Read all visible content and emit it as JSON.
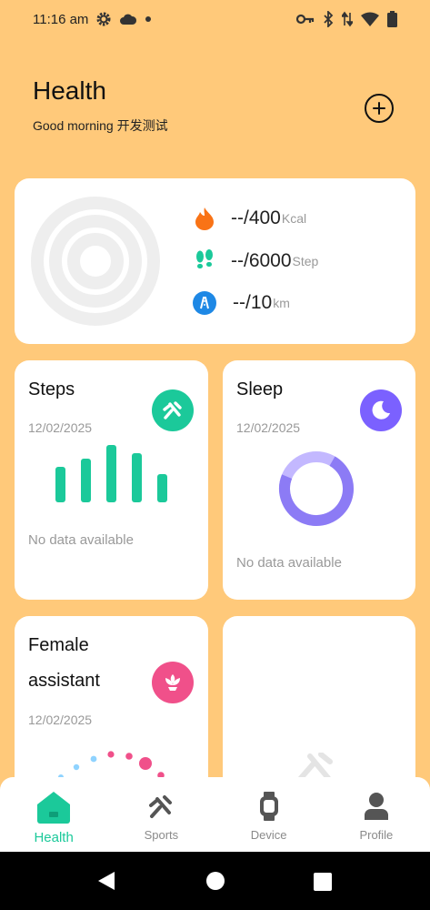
{
  "status_bar": {
    "time": "11:16 am",
    "icons": [
      "settings-gear-icon",
      "cloud-icon",
      "dot-icon",
      "key-icon",
      "bluetooth-icon",
      "data-arrows-icon",
      "wifi-icon",
      "battery-icon"
    ]
  },
  "header": {
    "title": "Health",
    "greeting": "Good morning 开发测试",
    "add_icon": "plus-circle-icon"
  },
  "summary": {
    "calories": {
      "value": "--/400",
      "unit": "Kcal",
      "icon": "flame-icon",
      "color": "#F97316"
    },
    "steps": {
      "value": "--/6000",
      "unit": "Step",
      "icon": "footprints-icon",
      "color": "#1BC99A"
    },
    "distance": {
      "value": "--/10",
      "unit": "km",
      "icon": "road-icon",
      "color": "#1E88E5"
    }
  },
  "tiles": {
    "steps": {
      "title": "Steps",
      "date": "12/02/2025",
      "no_data": "No data available",
      "icon": "running-icon",
      "color": "#1BC99A"
    },
    "sleep": {
      "title": "Sleep",
      "date": "12/02/2025",
      "no_data": "No data available",
      "icon": "moon-icon",
      "color": "#7B61FF"
    },
    "female": {
      "title_line1": "Female",
      "title_line2": "assistant",
      "date": "12/02/2025",
      "icon": "flower-icon",
      "color": "#F0508A"
    }
  },
  "bottom_nav": [
    {
      "label": "Health",
      "icon": "home-icon",
      "active": true
    },
    {
      "label": "Sports",
      "icon": "running-icon",
      "active": false
    },
    {
      "label": "Device",
      "icon": "watch-icon",
      "active": false
    },
    {
      "label": "Profile",
      "icon": "person-icon",
      "active": false
    }
  ],
  "colors": {
    "background": "#FFC97A",
    "accent": "#1BC99A",
    "sleep": "#7B61FF",
    "female": "#F0508A"
  }
}
